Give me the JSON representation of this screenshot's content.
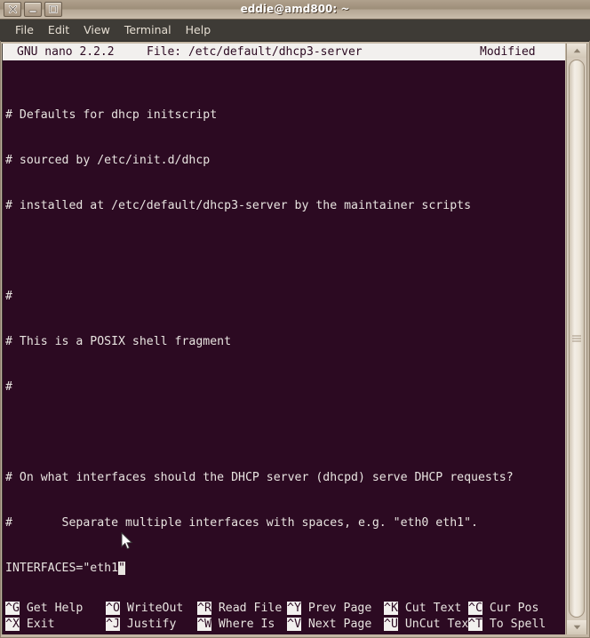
{
  "window": {
    "title": "eddie@amd800: ~",
    "buttons": [
      {
        "name": "close",
        "glyph": "✕"
      },
      {
        "name": "minimize",
        "glyph": "—"
      },
      {
        "name": "maximize",
        "glyph": "□"
      }
    ]
  },
  "menubar": {
    "items": [
      {
        "label": "File"
      },
      {
        "label": "Edit"
      },
      {
        "label": "View"
      },
      {
        "label": "Terminal"
      },
      {
        "label": "Help"
      }
    ]
  },
  "nano": {
    "version": "GNU nano 2.2.2",
    "file_label": "File: /etc/default/dhcp3-server",
    "status": "Modified",
    "lines": [
      "# Defaults for dhcp initscript",
      "# sourced by /etc/init.d/dhcp",
      "# installed at /etc/default/dhcp3-server by the maintainer scripts",
      "",
      "#",
      "# This is a POSIX shell fragment",
      "#",
      "",
      "# On what interfaces should the DHCP server (dhcpd) serve DHCP requests?",
      "#       Separate multiple interfaces with spaces, e.g. \"eth0 eth1\"."
    ],
    "cursor_line": {
      "before": "INTERFACES=\"eth1",
      "at_cursor": "\"",
      "after": ""
    },
    "shortcuts_row1": [
      {
        "key": "^G",
        "label": " Get Help"
      },
      {
        "key": "^O",
        "label": " WriteOut"
      },
      {
        "key": "^R",
        "label": " Read File"
      },
      {
        "key": "^Y",
        "label": " Prev Page"
      },
      {
        "key": "^K",
        "label": " Cut Text"
      },
      {
        "key": "^C",
        "label": " Cur Pos"
      }
    ],
    "shortcuts_row2": [
      {
        "key": "^X",
        "label": " Exit"
      },
      {
        "key": "^J",
        "label": " Justify"
      },
      {
        "key": "^W",
        "label": " Where Is"
      },
      {
        "key": "^V",
        "label": " Next Page"
      },
      {
        "key": "^U",
        "label": " UnCut Text"
      },
      {
        "key": "^T",
        "label": " To Spell"
      }
    ]
  },
  "colors": {
    "terminal_bg": "#2c0a22",
    "terminal_fg": "#e8e4e0",
    "titlebar": "#a3947f",
    "menubar_bg": "#3e3b36"
  }
}
